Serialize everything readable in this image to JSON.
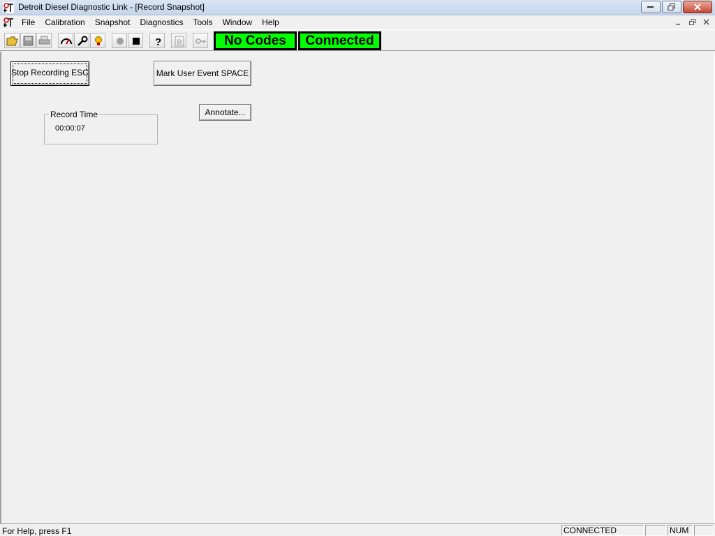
{
  "window": {
    "title": "Detroit Diesel Diagnostic Link - [Record Snapshot]",
    "app_icon": "ddl-app-icon"
  },
  "menu": {
    "items": [
      "File",
      "Calibration",
      "Snapshot",
      "Diagnostics",
      "Tools",
      "Window",
      "Help"
    ]
  },
  "toolbar": {
    "buttons": [
      "open-icon",
      "save-icon",
      "print-icon",
      "gauge-icon",
      "wrench-icon",
      "bulb-icon",
      "record-icon",
      "stop-icon",
      "help-icon",
      "reset-icon",
      "key-icon"
    ],
    "no_codes": "No Codes",
    "connected": "Connected",
    "status_color": "#00ff00"
  },
  "record": {
    "stop_label": "Stop Recording ESC",
    "mark_label": "Mark User Event SPACE",
    "annotate_label": "Annotate...",
    "record_time_label": "Record Time",
    "record_time_value": "00:00:07"
  },
  "statusbar": {
    "help_text": "For Help, press F1",
    "connection": "CONNECTED",
    "num": "NUM"
  }
}
